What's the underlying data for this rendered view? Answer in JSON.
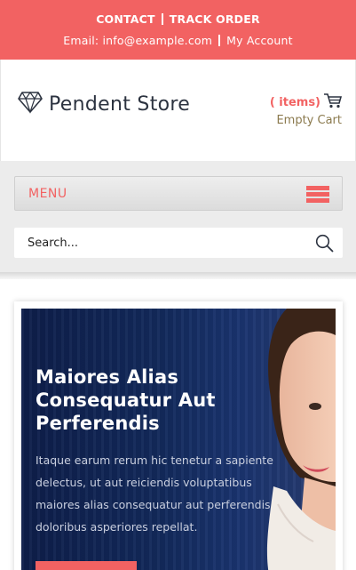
{
  "topbar": {
    "contact": "CONTACT",
    "track_order": "TRACK ORDER",
    "email": "Email: info@example.com",
    "my_account": "My Account"
  },
  "header": {
    "logo_text": "Pendent Store",
    "cart_items": "( items)",
    "cart_status": "Empty Cart"
  },
  "nav": {
    "menu_label": "MENU",
    "search_placeholder": "Search..."
  },
  "hero": {
    "title": "Maiores Alias Consequatur Aut Perferendis",
    "text": "Itaque earum rerum hic tenetur a sapiente delectus, ut aut reiciendis voluptatibus maiores alias consequatur aut perferendis doloribus asperiores repellat."
  },
  "colors": {
    "accent": "#f26262",
    "hero_bg": "#132a5c",
    "cart_status": "#8b7a4e"
  },
  "icons": {
    "logo": "diamond-icon",
    "cart": "cart-icon",
    "menu": "hamburger-icon",
    "search": "search-icon"
  }
}
